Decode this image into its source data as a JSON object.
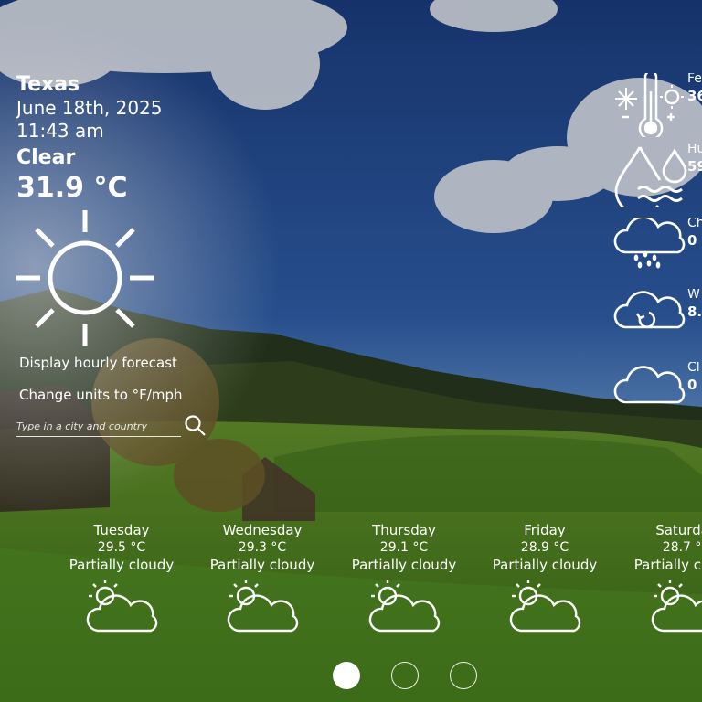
{
  "current": {
    "location": "Texas",
    "date": "June 18th, 2025",
    "time": "11:43 am",
    "condition": "Clear",
    "temperature": "31.9 °C",
    "icon": "sun-icon"
  },
  "actions": {
    "hourly_label": "Display hourly forecast",
    "units_label": "Change units to °F/mph"
  },
  "search": {
    "placeholder": "Type in a city and country",
    "icon": "search-icon"
  },
  "metrics": [
    {
      "label": "Fe",
      "value": "36",
      "icon": "thermometer-icon"
    },
    {
      "label": "Hu",
      "value": "59",
      "icon": "humidity-icon"
    },
    {
      "label": "Ch",
      "value": "0",
      "icon": "rain-cloud-icon"
    },
    {
      "label": "W",
      "value": "8.",
      "icon": "wind-cloud-icon"
    },
    {
      "label": "Cl",
      "value": "0",
      "icon": "cloud-icon"
    }
  ],
  "forecast": [
    {
      "day": "Tuesday",
      "temp": "29.5 °C",
      "condition": "Partially cloudy",
      "icon": "partly-cloudy-icon"
    },
    {
      "day": "Wednesday",
      "temp": "29.3 °C",
      "condition": "Partially cloudy",
      "icon": "partly-cloudy-icon"
    },
    {
      "day": "Thursday",
      "temp": "29.1 °C",
      "condition": "Partially cloudy",
      "icon": "partly-cloudy-icon"
    },
    {
      "day": "Friday",
      "temp": "28.9 °C",
      "condition": "Partially cloudy",
      "icon": "partly-cloudy-icon"
    },
    {
      "day": "Saturday",
      "temp": "28.7 °C",
      "condition": "Partially cloudy",
      "icon": "partly-cloudy-icon"
    }
  ],
  "pagination": {
    "pages": 3,
    "active": 1
  }
}
